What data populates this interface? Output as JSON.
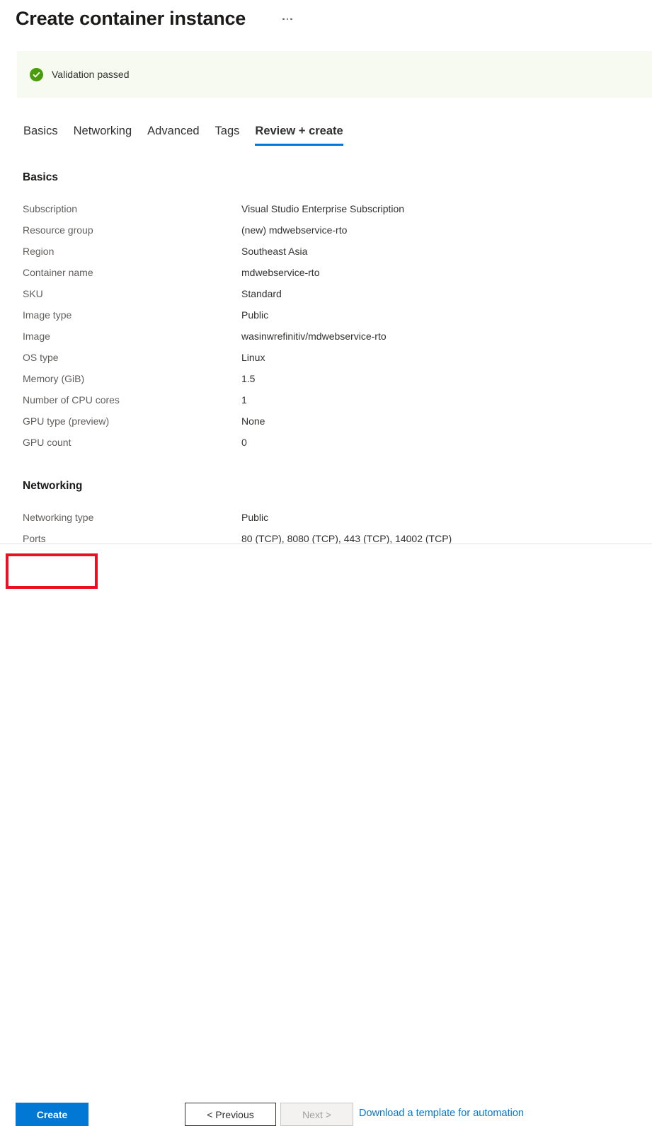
{
  "header": {
    "title": "Create container instance",
    "more_menu_label": "More",
    "more_icon": "ellipsis-icon"
  },
  "validation": {
    "icon": "check-circle-icon",
    "text": "Validation passed",
    "background_color": "#f6faf0",
    "icon_color": "#4a9c0d"
  },
  "tabs": [
    {
      "label": "Basics",
      "active": false
    },
    {
      "label": "Networking",
      "active": false
    },
    {
      "label": "Advanced",
      "active": false
    },
    {
      "label": "Tags",
      "active": false
    },
    {
      "label": "Review + create",
      "active": true
    }
  ],
  "accent_color": "#0078d4",
  "highlight_color": "#e81123",
  "sections": [
    {
      "id": "basics",
      "title": "Basics",
      "rows": [
        {
          "key": "Subscription",
          "value": "Visual Studio Enterprise Subscription"
        },
        {
          "key": "Resource group",
          "value": "(new) mdwebservice-rto"
        },
        {
          "key": "Region",
          "value": "Southeast Asia"
        },
        {
          "key": "Container name",
          "value": "mdwebservice-rto"
        },
        {
          "key": "SKU",
          "value": "Standard"
        },
        {
          "key": "Image type",
          "value": "Public"
        },
        {
          "key": "Image",
          "value": "wasinwrefinitiv/mdwebservice-rto"
        },
        {
          "key": "OS type",
          "value": "Linux"
        },
        {
          "key": "Memory (GiB)",
          "value": "1.5"
        },
        {
          "key": "Number of CPU cores",
          "value": "1"
        },
        {
          "key": "GPU type (preview)",
          "value": "None"
        },
        {
          "key": "GPU count",
          "value": "0"
        }
      ]
    },
    {
      "id": "networking",
      "title": "Networking",
      "rows": [
        {
          "key": "Networking type",
          "value": "Public"
        },
        {
          "key": "Ports",
          "value": "80 (TCP), 8080 (TCP), 443 (TCP), 14002 (TCP)"
        }
      ]
    }
  ],
  "footer": {
    "create_label": "Create",
    "previous_label": "< Previous",
    "next_label": "Next >",
    "next_disabled": true,
    "template_link_label": "Download a template for automation"
  }
}
